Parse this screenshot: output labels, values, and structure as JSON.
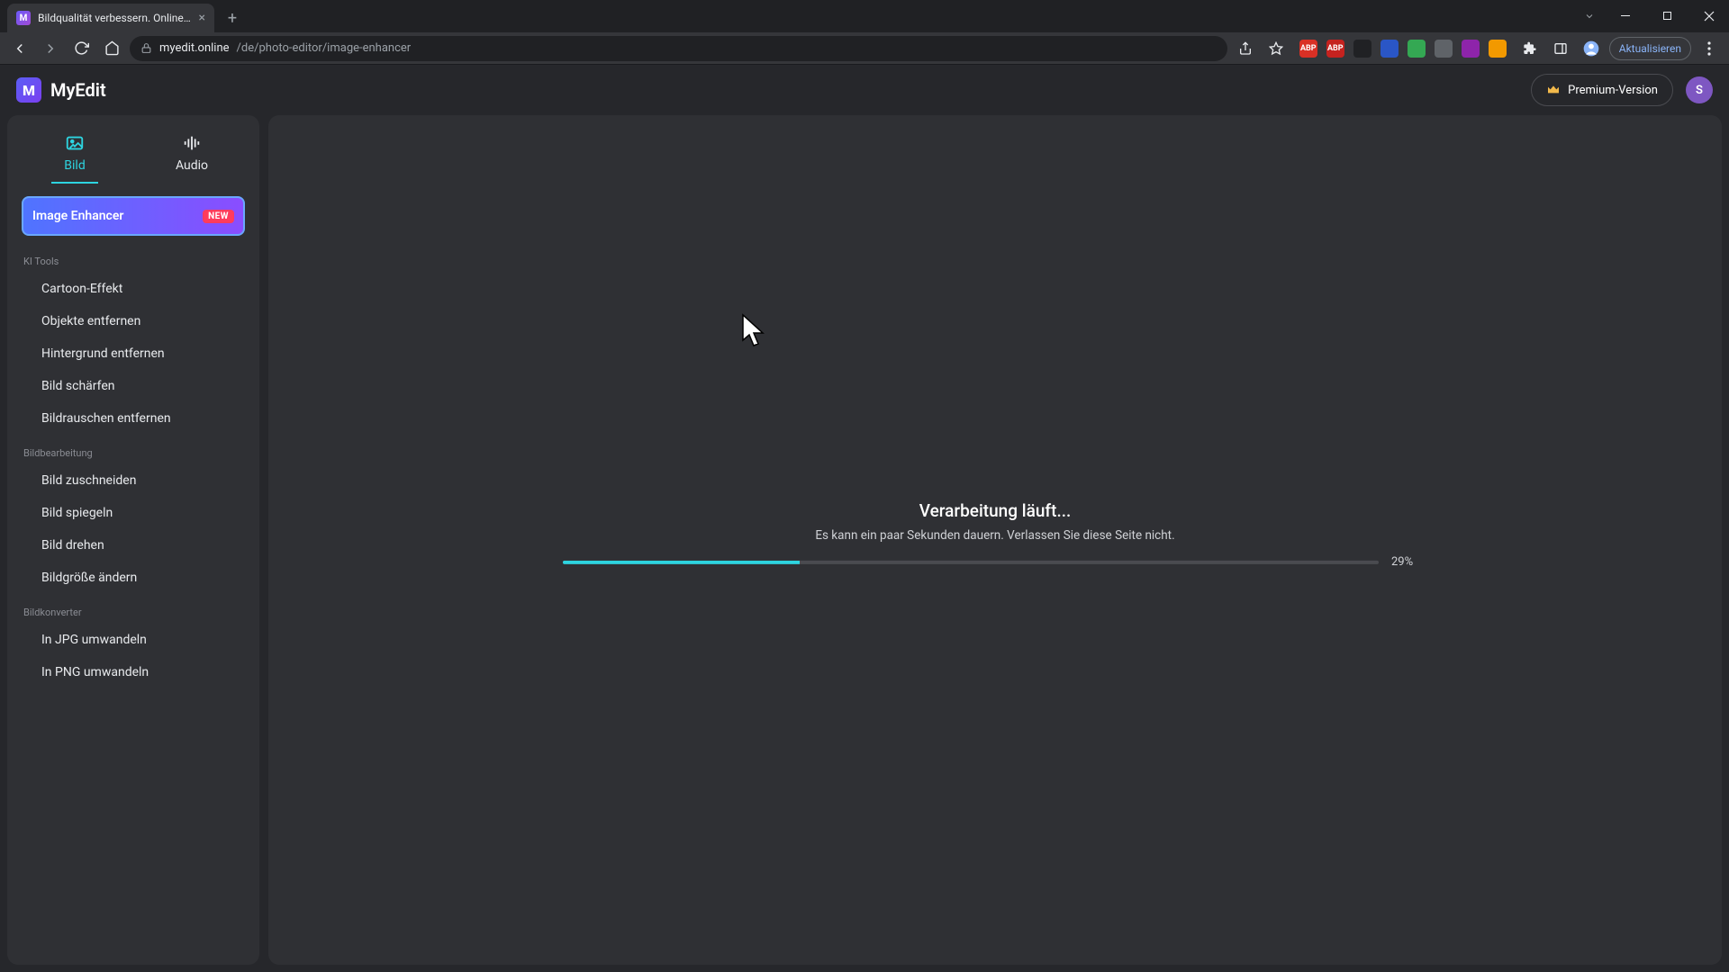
{
  "browser": {
    "tab_title": "Bildqualität verbessern. Online m",
    "tab_favicon_letter": "M",
    "url_host": "myedit.online",
    "url_path": "/de/photo-editor/image-enhancer",
    "refresh_label": "Aktualisieren",
    "extensions": [
      {
        "name": "abp-icon",
        "text": "ABP",
        "bg": "#d93025",
        "fg": "#ffffff"
      },
      {
        "name": "abp2-icon",
        "text": "ABP",
        "bg": "#c5221f",
        "fg": "#ffffff"
      },
      {
        "name": "ext3-icon",
        "text": "",
        "bg": "#202124",
        "fg": "#9aa0a6"
      },
      {
        "name": "ext4-icon",
        "text": "",
        "bg": "#2a56c6",
        "fg": "#ffffff"
      },
      {
        "name": "ext5-icon",
        "text": "",
        "bg": "#34a853",
        "fg": "#ffffff"
      },
      {
        "name": "ext6-icon",
        "text": "",
        "bg": "#5f6368",
        "fg": "#ffffff"
      },
      {
        "name": "ext7-icon",
        "text": "",
        "bg": "#8e24aa",
        "fg": "#ffffff"
      },
      {
        "name": "ext8-icon",
        "text": "",
        "bg": "#f29900",
        "fg": "#ffffff"
      }
    ]
  },
  "app": {
    "brand_logo_letter": "M",
    "brand_name": "MyEdit",
    "premium_label": "Premium-Version",
    "avatar_initial": "S"
  },
  "sidebar": {
    "tabs": {
      "image": "Bild",
      "audio": "Audio"
    },
    "feature": {
      "label": "Image Enhancer",
      "badge": "NEW"
    },
    "groups": [
      {
        "title": "KI Tools",
        "items": [
          "Cartoon-Effekt",
          "Objekte entfernen",
          "Hintergrund entfernen",
          "Bild schärfen",
          "Bildrauschen entfernen"
        ]
      },
      {
        "title": "Bildbearbeitung",
        "items": [
          "Bild zuschneiden",
          "Bild spiegeln",
          "Bild drehen",
          "Bildgröße ändern"
        ]
      },
      {
        "title": "Bildkonverter",
        "items": [
          "In JPG umwandeln",
          "In PNG umwandeln"
        ]
      }
    ]
  },
  "progress": {
    "title": "Verarbeitung läuft...",
    "subtitle": "Es kann ein paar Sekunden dauern. Verlassen Sie diese Seite nicht.",
    "percent_value": 29,
    "percent_label": "29%"
  },
  "colors": {
    "accent": "#2dd4e0",
    "panel": "#2f3034",
    "bg": "#26272b"
  }
}
